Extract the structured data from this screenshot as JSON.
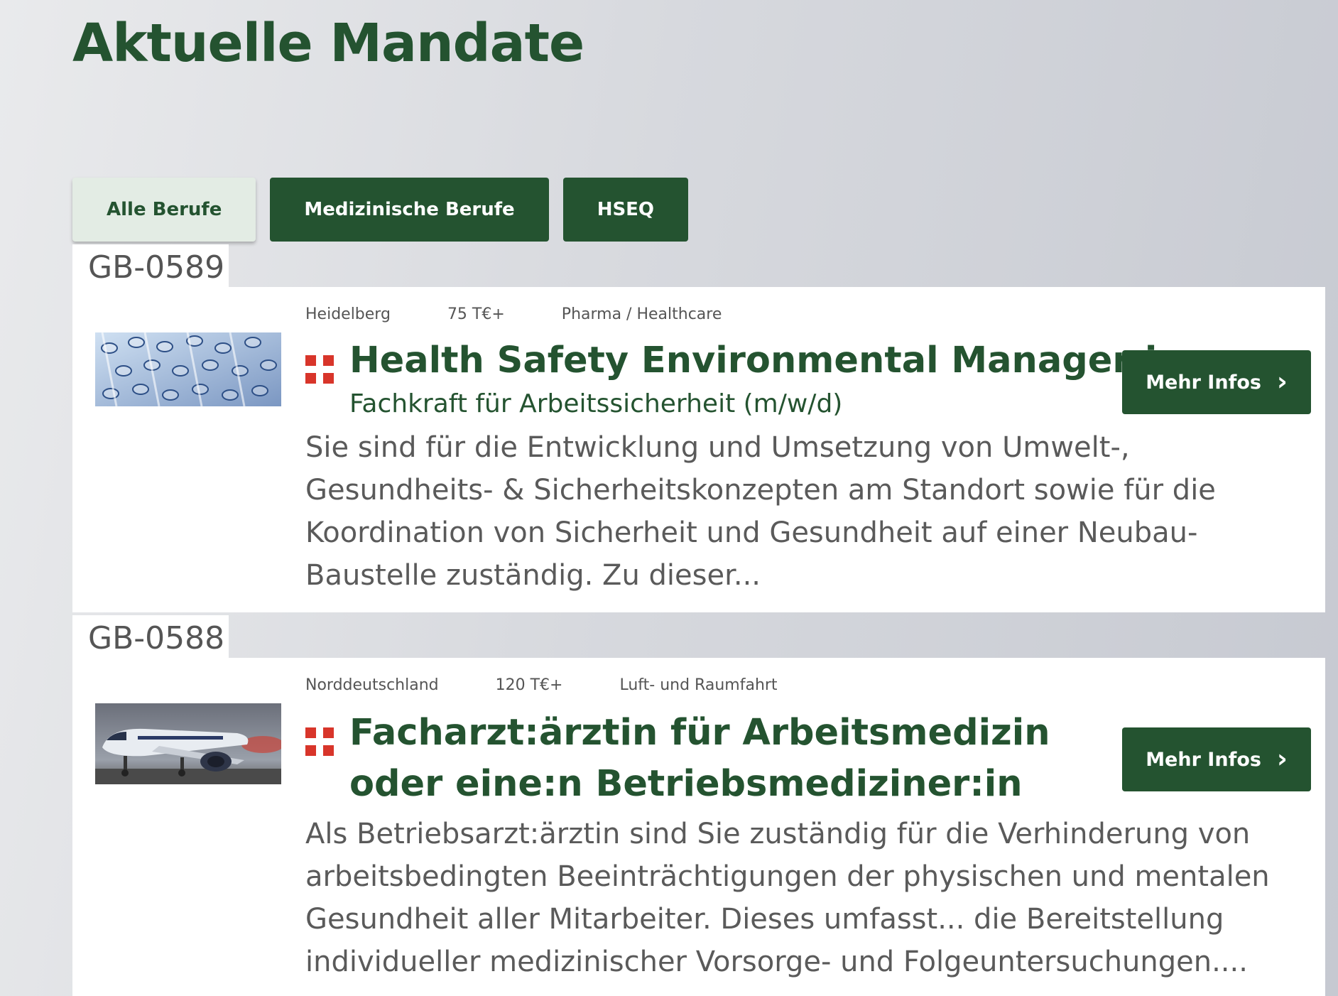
{
  "page": {
    "title": "Aktuelle Mandate"
  },
  "filters": [
    {
      "label": "Alle Berufe",
      "active": true
    },
    {
      "label": "Medizinische Berufe",
      "active": false
    },
    {
      "label": "HSEQ",
      "active": false
    }
  ],
  "jobs": [
    {
      "id": "GB-0589",
      "location": "Heidelberg",
      "salary": "75 T€+",
      "industry": "Pharma / Healthcare",
      "title": "Health Safety Environmental Manager:in",
      "subtitle": "Fachkraft für Arbeitssicherheit (m/w/d)",
      "description": "Sie sind für die Entwicklung und Umsetzung von Umwelt-, Gesundheits- & Sicherheitskonzepten am Standort sowie für die Koordination von Sicherheit und Gesundheit auf einer Neubau-Baustelle zuständig. Zu dieser...",
      "button": "Mehr Infos",
      "image": "test-tubes-image"
    },
    {
      "id": "GB-0588",
      "location": "Norddeutschland",
      "salary": "120 T€+",
      "industry": "Luft- und Raumfahrt",
      "title": "Facharzt:ärztin für Arbeitsmedizin oder eine:n Betriebsmediziner:in",
      "subtitle": "",
      "description": "Als Betriebsarzt:ärztin sind Sie zuständig für die Verhinderung von arbeitsbedingten Beeinträchtigungen der physischen und mentalen Gesundheit aller Mitarbeiter. Dieses umfasst...   die Bereitstellung individueller medizinischer Vorsorge- und Folgeuntersuchungen....",
      "button": "Mehr Infos",
      "image": "airplane-image"
    }
  ],
  "colors": {
    "brand": "#245330",
    "accent": "#d8352a"
  }
}
